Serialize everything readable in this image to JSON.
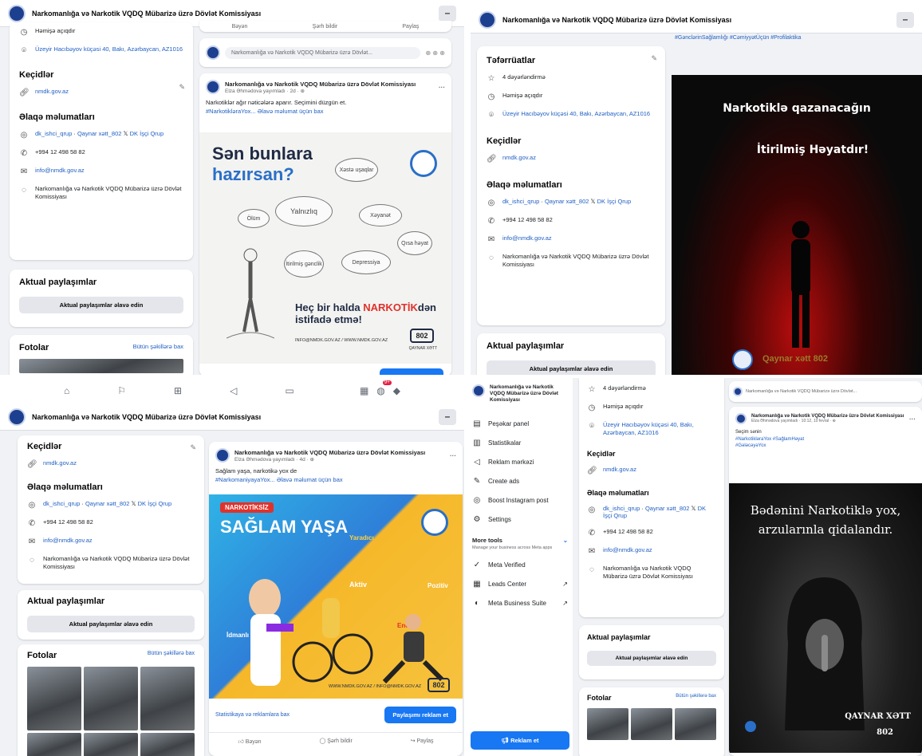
{
  "page_title": "Narkomanlığa və Narkotik VQDQ Mübarizə üzrə Dövlət Komissiyası",
  "minimize_label": "–",
  "about": {
    "details_heading": "Təfərrüatlar",
    "rating": "4 dəyərləndirmə",
    "hours": "Həmişə açıqdır",
    "address": "Üzeyir Hacıbəyov küçəsi 40, Bakı, Azərbaycan, AZ1016",
    "links_heading": "Keçidlər",
    "website": "nmdk.gov.az",
    "contact_heading": "Əlaqə məlumatları",
    "social_dk": "dk_ishci_qrup",
    "social_hotline": "Qaynar xətt_802",
    "social_x": "DK İşçi Qrup",
    "phone": "+994 12 498 58 82",
    "email": "info@nmdk.gov.az",
    "messenger": "Narkomanlığa və Narkotik VQDQ Mübarizə üzrə Dövlət Komissiyası",
    "featured_heading": "Aktual paylaşımlar",
    "featured_button": "Aktual paylaşımlar əlavə edin",
    "photos_heading": "Fotolar",
    "photos_all": "Bütün şəkillərə bax"
  },
  "post_actions": {
    "like": "Bəyən",
    "comment": "Şərh bildir",
    "share": "Paylaş"
  },
  "composer_placeholder": "Narkomanlığa və Narkotik VQDQ Mübarizə üzrə Dövlət...",
  "post1": {
    "author": "Narkomanlığa və Narkotik VQDQ Mübarizə üzrə Dövlət Komissiyası",
    "meta": "Elza Əhmədova yayımladı · 2d · ⊕",
    "text": "Narkotiklər ağır nəticələrə aparır. Seçimini düzgün et.",
    "tags": "#NarkotikləraYox... Əlavə məlumat üçün bax",
    "poster_title_1": "Sən bunlara",
    "poster_title_2": "hazırsan?",
    "bubbles": [
      "Yalnızlıq",
      "Xəstə uşaqlar",
      "Ölüm",
      "Xəyanət",
      "Qısa həyat",
      "Depressiya",
      "İtirilmiş gənclik"
    ],
    "slogan_1": "Heç bir halda",
    "slogan_red": "NARKOTİK",
    "slogan_2": "dən istifadə etmə!",
    "footer": "INFO@NMDK.GOV.AZ / WWW.NMDK.GOV.AZ",
    "hotline_badge": "802",
    "hotline_caption": "QAYNAR XƏTT"
  },
  "post2": {
    "tags": "#GənclərinSağlamlığı #CəmiyyətÜçün #Profilaktika",
    "line1": "Narkotiklə qazanacağın",
    "line2": "İtirilmiş Həyatdır!",
    "footer": "Qaynar xətt 802"
  },
  "post3": {
    "author": "Narkomanlığa və Narkotik VQDQ Mübarizə üzrə Dövlət Komissiyası",
    "meta": "Elza Əhmədova yayımladı · 4d · ⊕",
    "text": "Sağlam yaşa, narkotikə yox de",
    "tags": "#NarkomaniyayaYox... Əlavə məlumat üçün bax",
    "badge": "NARKOTİKSİZ",
    "headline": "SAĞLAM YAŞA",
    "w1": "Yaradıcı",
    "w2": "Aktiv",
    "w3": "Pozitiv",
    "w4": "İdmanlı",
    "w5": "Enerjili",
    "footer": "WWW.NMDK.GOV.AZ / INFO@NMDK.GOV.AZ",
    "hotline_badge": "802",
    "insights": "Statistikaya və reklamlara bax",
    "boost": "Paylaşımı reklam et"
  },
  "post4": {
    "author": "Narkomanlığa və Narkotik VQDQ Mübarizə üzrə Dövlət Komissiyası",
    "meta": "Elza Əhmədova yayımladı · 10:12, 10 fevral · ⊕",
    "text": "Seçim sənin",
    "tags": "#NarkotikləraYox #SağlamHəyat #GələcəyəYox",
    "line1": "Bədənini Narkotiklə yox,",
    "line2": "arzularınla qidalandır.",
    "footer_1": "QAYNAR XƏTT",
    "footer_2": "802"
  },
  "nav": {
    "title": "Narkomanlığa və Narkotik VQDQ Mübarizə üzrə Dövlət Komissiyası",
    "items": [
      "Peşəkar panel",
      "Statistikalar",
      "Reklam mərkəzi",
      "Create ads",
      "Boost Instagram post",
      "Settings"
    ],
    "more_tools": "More tools",
    "more_tools_sub": "Manage your business across Meta apps",
    "tools": [
      "Meta Verified",
      "Leads Center",
      "Meta Business Suite"
    ],
    "advertise": "Reklam et"
  },
  "notifications_count": "9+",
  "colors": {
    "fb_blue": "#1877f2",
    "brand_navy": "#1d3f8f",
    "link": "#2160c4",
    "page_bg": "#f0f2f5"
  }
}
